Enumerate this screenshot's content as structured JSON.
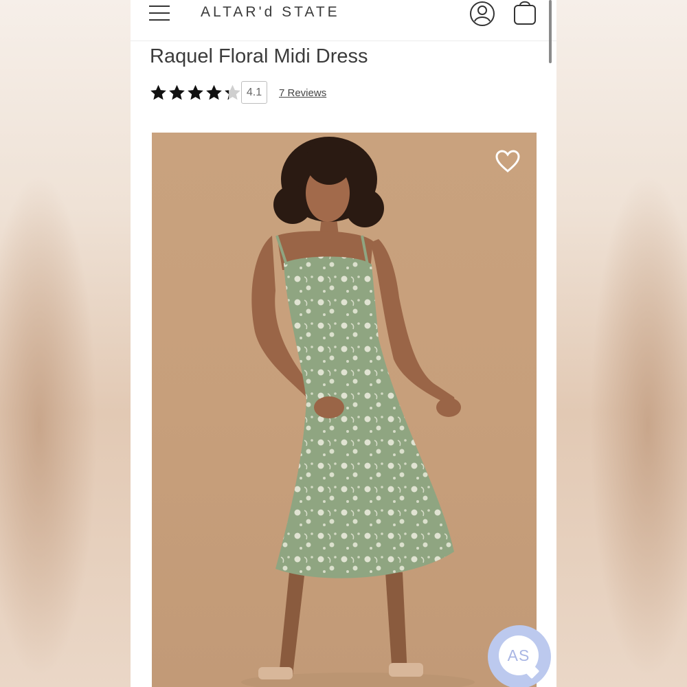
{
  "header": {
    "brand": "ALTAR'd STATE",
    "menu_icon": "hamburger-menu-icon",
    "account_icon": "user-account-icon",
    "bag_icon": "shopping-bag-icon"
  },
  "product": {
    "title": "Raquel Floral Midi Dress",
    "rating_value": "4.1",
    "rating_out_of": 5,
    "reviews_label": "7 Reviews",
    "wishlist_icon": "heart-icon",
    "image_subject": "model in sage green floral satin slip midi dress"
  },
  "chat": {
    "label": "AS",
    "icon": "chat-bubble-icon",
    "color": "#bcc9ee"
  },
  "colors": {
    "text": "#3b3b3b",
    "image_background": "#c9a27e",
    "dress": "#8fa581"
  }
}
